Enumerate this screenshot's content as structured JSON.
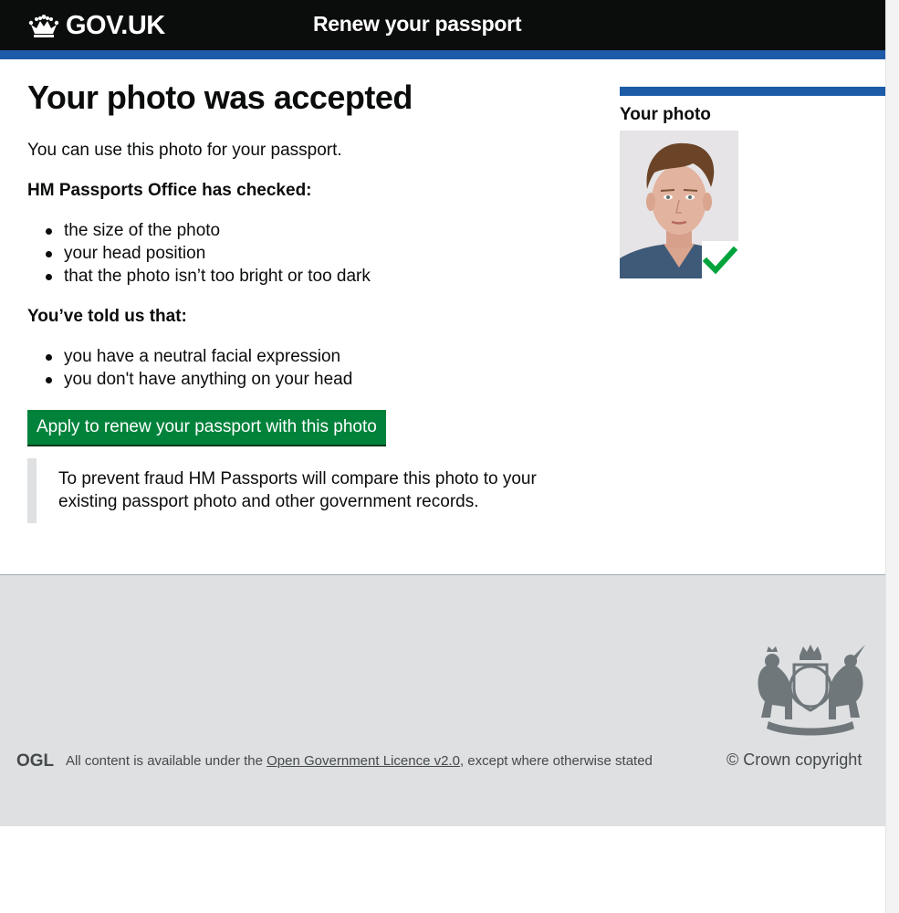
{
  "header": {
    "logo_text": "GOV.UK",
    "service_name": "Renew your passport"
  },
  "main": {
    "title": "Your photo was accepted",
    "intro": "You can use this photo for your passport.",
    "checked_heading": "HM Passports Office has checked:",
    "checked_items": [
      "the size of the photo",
      "your head position",
      "that the photo isn’t too bright or too dark"
    ],
    "told_heading": "You’ve told us that:",
    "told_items": [
      "you have a neutral facial expression",
      "you don't have anything on your head"
    ],
    "apply_button": "Apply to renew your passport with this photo",
    "inset_text": "To prevent fraud HM Passports will compare this photo to your existing passport photo and other government records."
  },
  "sidebar": {
    "title": "Your photo"
  },
  "footer": {
    "ogl_label": "OGL",
    "licence_prefix": "All content is available under the ",
    "licence_link": "Open Government Licence v2.0",
    "licence_suffix": ", except where otherwise stated",
    "copyright": "© Crown copyright"
  },
  "colors": {
    "header_bg": "#0b0c0c",
    "brand_blue": "#1d5aa8",
    "button_green": "#00823b",
    "footer_bg": "#dee0e2",
    "tick_green": "#00a33b"
  },
  "icons": [
    "crown-icon",
    "tick-icon",
    "ogl-icon",
    "royal-crest-icon"
  ]
}
